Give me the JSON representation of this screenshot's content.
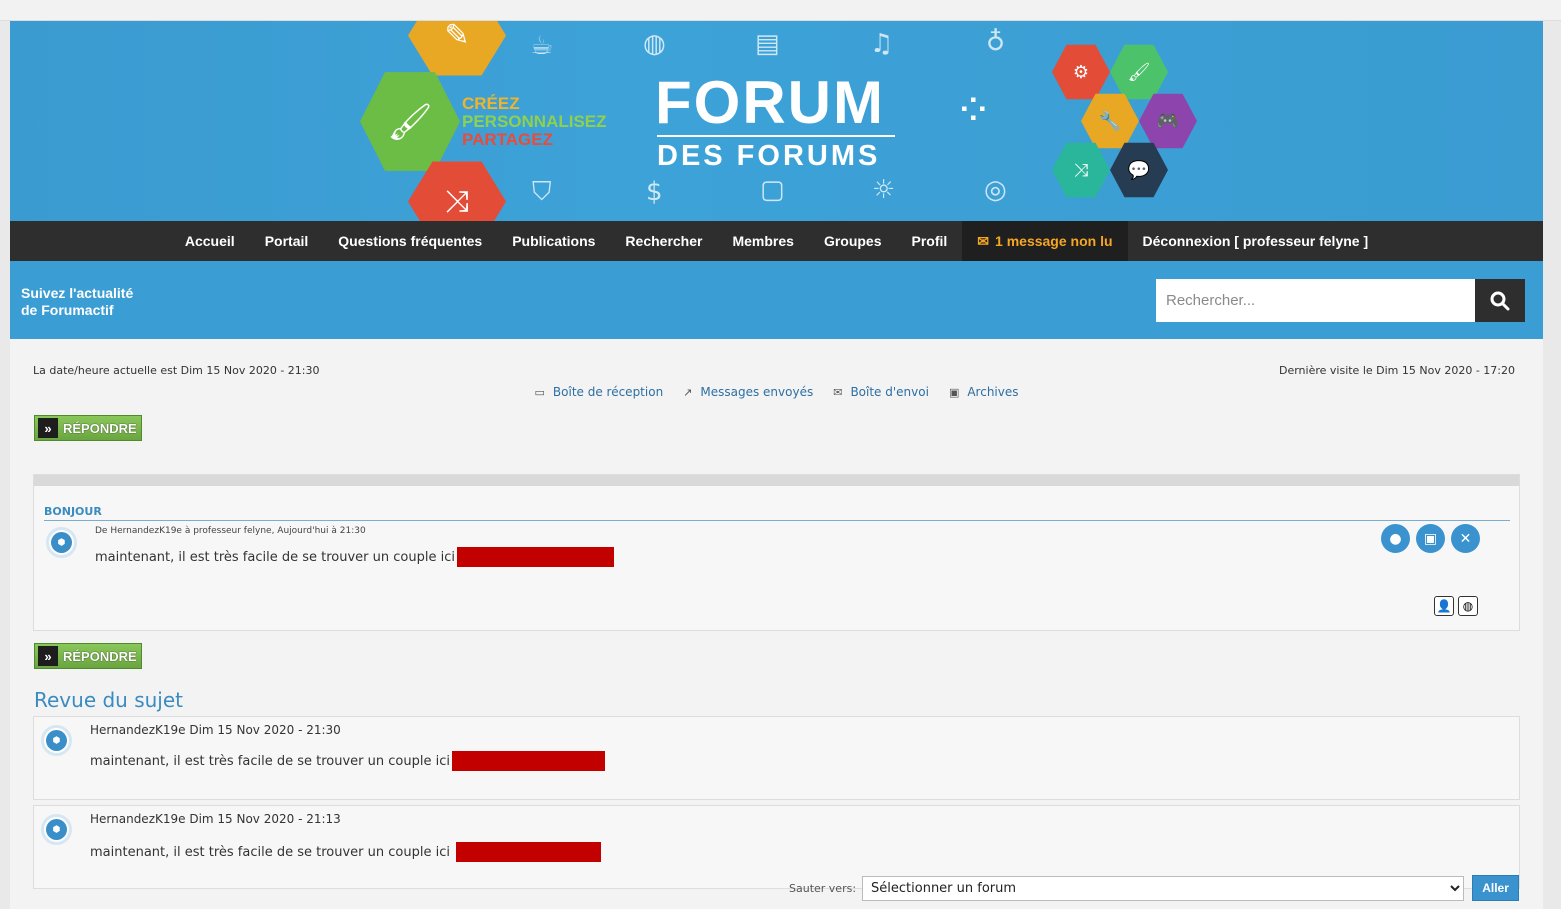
{
  "banner": {
    "slogan": [
      "CRÉEZ",
      "PERSONNALISEZ",
      "PARTAGEZ"
    ],
    "slogan_colors": [
      "#f0b429",
      "#8fd14f",
      "#e74c3c"
    ],
    "title_big": "FORUM",
    "title_small": "DES FORUMS"
  },
  "nav": {
    "items": [
      "Accueil",
      "Portail",
      "Questions fréquentes",
      "Publications",
      "Rechercher",
      "Membres",
      "Groupes",
      "Profil"
    ],
    "unread": "1 message non lu",
    "logout": "Déconnexion [ professeur felyne ]"
  },
  "subbar": {
    "follow_line1": "Suivez l'actualité",
    "follow_line2": "de Forumactif",
    "search_placeholder": "Rechercher..."
  },
  "info": {
    "date_now": "La date/heure actuelle est Dim 15 Nov 2020 - 21:30",
    "last_visit": "Dernière visite le Dim 15 Nov 2020 - 17:20"
  },
  "pm_links": [
    "Boîte de réception",
    "Messages envoyés",
    "Boîte d'envoi",
    "Archives"
  ],
  "reply_label": "RÉPONDRE",
  "post": {
    "subject": "BONJOUR",
    "meta": "De HernandezK19e à professeur felyne, Aujourd'hui à 21:30",
    "text": "maintenant, il est très facile de se trouver un couple ici"
  },
  "review": {
    "title": "Revue du sujet",
    "posts": [
      {
        "meta": "HernandezK19e Dim 15 Nov 2020 - 21:30",
        "text": "maintenant, il est très facile de se trouver un couple ici"
      },
      {
        "meta": "HernandezK19e Dim 15 Nov 2020 - 21:13",
        "text": "maintenant, il est très facile de se trouver un couple ici"
      }
    ]
  },
  "jump": {
    "label": "Sauter vers:",
    "selected": "Sélectionner un forum",
    "go": "Aller"
  },
  "colors": {
    "accent": "#3a9dd3",
    "navbar": "#2e2e2e",
    "unread": "#f5a623",
    "redaction": "#c20000"
  }
}
